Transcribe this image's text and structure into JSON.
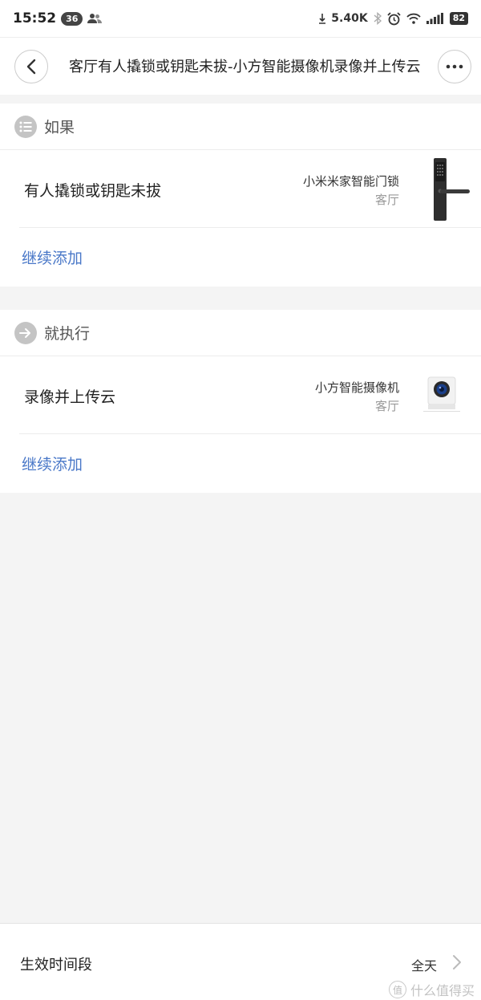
{
  "status_bar": {
    "time": "15:52",
    "notification_count": "36",
    "net_speed": "5.40K",
    "battery": "82"
  },
  "header": {
    "title": "客厅有人撬锁或钥匙未拔-小方智能摄像机录像并上传云"
  },
  "if_section": {
    "title": "如果",
    "condition": {
      "label": "有人撬锁或钥匙未拔",
      "device_name": "小米米家智能门锁",
      "room": "客厅"
    },
    "add_label": "继续添加"
  },
  "then_section": {
    "title": "就执行",
    "action": {
      "label": "录像并上传云",
      "device_name": "小方智能摄像机",
      "room": "客厅"
    },
    "add_label": "继续添加"
  },
  "bottom": {
    "period_label": "生效时间段",
    "period_value": "全天"
  },
  "watermark": {
    "logo_text": "值",
    "text": "什么值得买"
  },
  "colors": {
    "accent_link": "#4a78c8",
    "section_icon_bg": "#c4c4c4",
    "page_bg": "#f4f4f4"
  },
  "icons": [
    "chevron-left-icon",
    "more-dots-icon",
    "list-icon",
    "arrow-right-icon",
    "chevron-right-icon",
    "wifi-icon",
    "signal-icon",
    "alarm-icon",
    "bluetooth-icon"
  ]
}
